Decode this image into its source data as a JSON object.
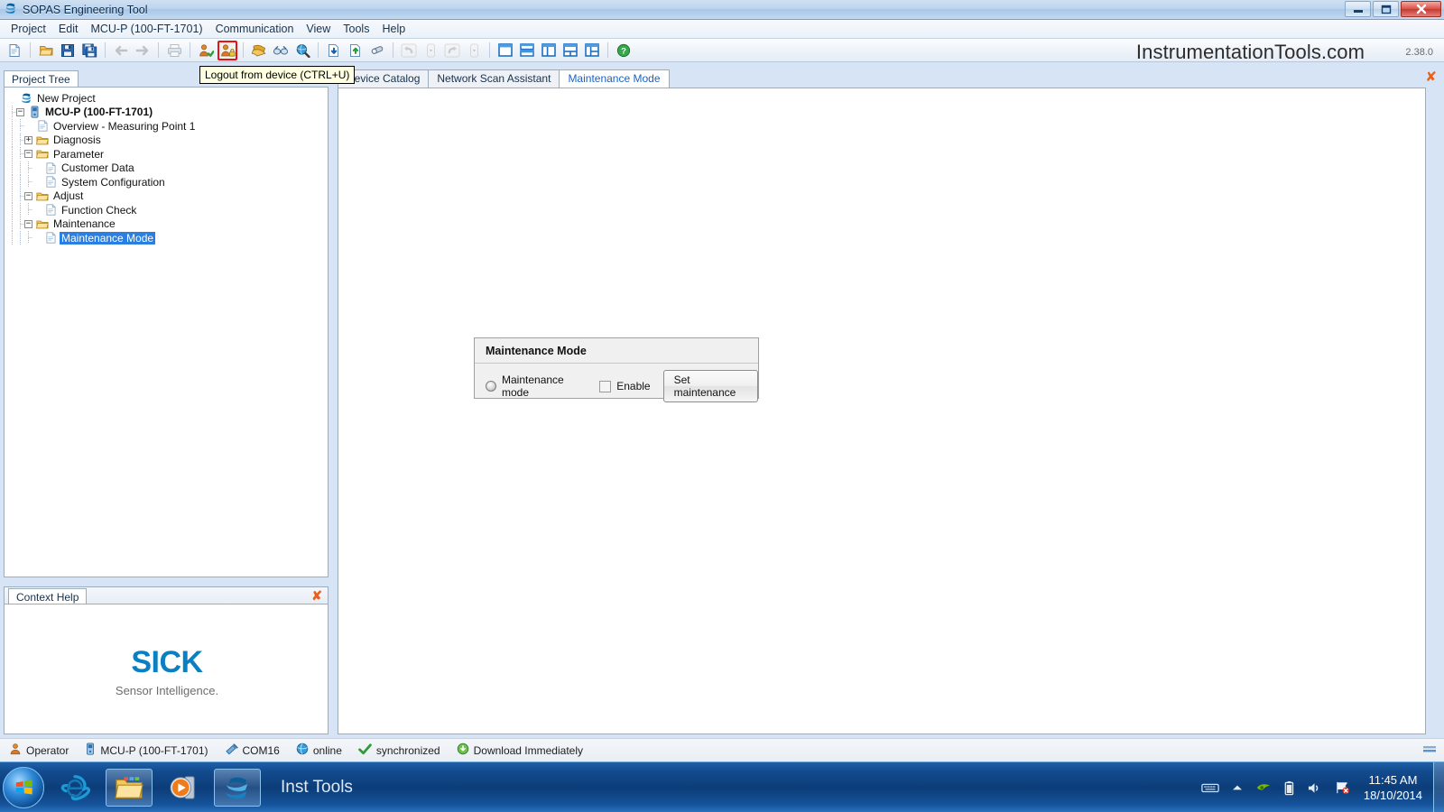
{
  "window": {
    "title": "SOPAS Engineering Tool",
    "app_icon": "sopas-app-icon",
    "controls": {
      "minimize": "–",
      "maximize": "❑",
      "close": "✕"
    }
  },
  "menubar": {
    "items": [
      {
        "label": "Project"
      },
      {
        "label": "Edit"
      },
      {
        "label": "MCU-P (100-FT-1701)"
      },
      {
        "label": "Communication"
      },
      {
        "label": "View"
      },
      {
        "label": "Tools"
      },
      {
        "label": "Help"
      }
    ]
  },
  "toolbar": {
    "watermark": "InstrumentationTools.com",
    "version": "2.38.0",
    "tooltip": "Logout from device (CTRL+U)",
    "buttons": [
      {
        "name": "new-project-icon",
        "group": 0
      },
      {
        "name": "open-project-icon",
        "group": 1
      },
      {
        "name": "save-icon",
        "group": 1
      },
      {
        "name": "save-all-icon",
        "group": 1
      },
      {
        "name": "back-icon",
        "group": 2
      },
      {
        "name": "forward-icon",
        "group": 2
      },
      {
        "name": "print-icon",
        "group": 3
      },
      {
        "name": "login-to-device-icon",
        "group": 4
      },
      {
        "name": "logout-from-device-icon",
        "group": 4
      },
      {
        "name": "device-catalog-icon",
        "group": 5
      },
      {
        "name": "scan-devices-icon",
        "group": 5
      },
      {
        "name": "network-scan-icon",
        "group": 5
      },
      {
        "name": "download-to-device-icon",
        "group": 6
      },
      {
        "name": "upload-from-device-icon",
        "group": 6
      },
      {
        "name": "clear-icon",
        "group": 6
      },
      {
        "name": "undo-icon",
        "group": 7
      },
      {
        "name": "undo-dropdown-icon",
        "group": 7
      },
      {
        "name": "redo-icon",
        "group": 7
      },
      {
        "name": "redo-dropdown-icon",
        "group": 7
      },
      {
        "name": "layout-single-icon",
        "group": 8
      },
      {
        "name": "layout-horizontal-split-icon",
        "group": 8
      },
      {
        "name": "layout-vertical-split-icon",
        "group": 8
      },
      {
        "name": "layout-three-bottom-icon",
        "group": 8
      },
      {
        "name": "layout-three-right-icon",
        "group": 8
      },
      {
        "name": "help-icon",
        "group": 9
      }
    ]
  },
  "project_tree": {
    "tab_label": "Project Tree",
    "nodes": [
      {
        "label": "New Project",
        "depth": 0,
        "icon": "sopas-project-icon",
        "expander": "none",
        "bold": false,
        "selected": false
      },
      {
        "label": "MCU-P (100-FT-1701)",
        "depth": 1,
        "icon": "device-icon",
        "expander": "collapse",
        "bold": true,
        "selected": false
      },
      {
        "label": "Overview - Measuring Point 1",
        "depth": 2,
        "icon": "page-icon",
        "expander": "none",
        "bold": false,
        "selected": false
      },
      {
        "label": "Diagnosis",
        "depth": 2,
        "icon": "folder-icon",
        "expander": "expand",
        "bold": false,
        "selected": false
      },
      {
        "label": "Parameter",
        "depth": 2,
        "icon": "folder-icon",
        "expander": "collapse",
        "bold": false,
        "selected": false
      },
      {
        "label": "Customer Data",
        "depth": 3,
        "icon": "page-icon",
        "expander": "none",
        "bold": false,
        "selected": false
      },
      {
        "label": "System Configuration",
        "depth": 3,
        "icon": "page-icon",
        "expander": "none",
        "bold": false,
        "selected": false
      },
      {
        "label": "Adjust",
        "depth": 2,
        "icon": "folder-icon",
        "expander": "collapse",
        "bold": false,
        "selected": false
      },
      {
        "label": "Function Check",
        "depth": 3,
        "icon": "page-icon",
        "expander": "none",
        "bold": false,
        "selected": false
      },
      {
        "label": "Maintenance",
        "depth": 2,
        "icon": "folder-icon",
        "expander": "collapse",
        "bold": false,
        "selected": false
      },
      {
        "label": "Maintenance Mode",
        "depth": 3,
        "icon": "page-icon",
        "expander": "none",
        "bold": false,
        "selected": true
      }
    ]
  },
  "context_help": {
    "tab_label": "Context Help",
    "close_icon": "close-icon",
    "logo_text": "SICK",
    "logo_tagline": "Sensor Intelligence.",
    "logo_color": "#0a7fc2"
  },
  "editor": {
    "close_icon": "close-icon",
    "tabs": [
      {
        "label": "Device Catalog",
        "active": false
      },
      {
        "label": "Network Scan Assistant",
        "active": false
      },
      {
        "label": "Maintenance Mode",
        "active": true
      }
    ],
    "card": {
      "title": "Maintenance Mode",
      "radio_label": "Maintenance mode",
      "radio_checked": false,
      "checkbox_label": "Enable",
      "checkbox_checked": false,
      "button_label": "Set maintenance"
    }
  },
  "statusbar": {
    "items": [
      {
        "label": "Operator",
        "icon": "user-icon"
      },
      {
        "label": "MCU-P (100-FT-1701)",
        "icon": "device-icon"
      },
      {
        "label": "COM16",
        "icon": "serial-port-icon"
      },
      {
        "label": "online",
        "icon": "globe-icon"
      },
      {
        "label": "synchronized",
        "icon": "check-icon"
      },
      {
        "label": "Download Immediately",
        "icon": "download-icon"
      }
    ]
  },
  "taskbar": {
    "start_icon": "windows-start-icon",
    "items": [
      {
        "name": "internet-explorer-icon",
        "pinned": false
      },
      {
        "name": "windows-explorer-icon",
        "pinned": true
      },
      {
        "name": "media-player-icon",
        "pinned": false
      },
      {
        "name": "sopas-taskbar-icon",
        "pinned": true
      }
    ],
    "active_window_title": "Inst Tools",
    "tray_icons": [
      {
        "name": "keyboard-layout-icon"
      },
      {
        "name": "show-hidden-icons-icon"
      },
      {
        "name": "nvidia-icon"
      },
      {
        "name": "battery-icon"
      },
      {
        "name": "volume-icon"
      },
      {
        "name": "action-center-alert-icon"
      }
    ],
    "clock_time": "11:45 AM",
    "clock_date": "18/10/2014"
  }
}
